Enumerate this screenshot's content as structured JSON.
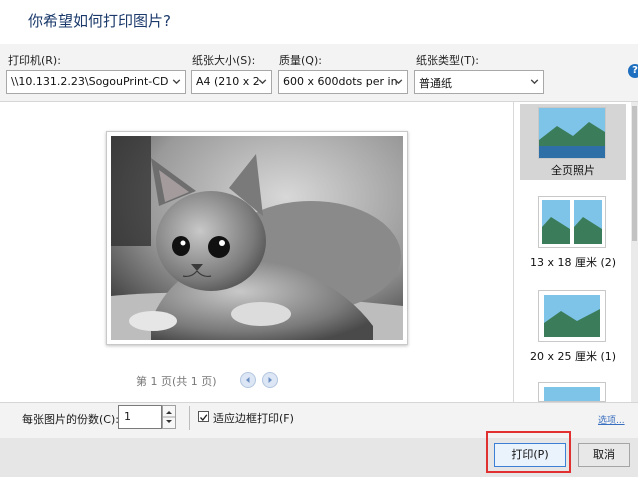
{
  "dialog": {
    "title": "你希望如何打印图片?"
  },
  "toolbar": {
    "printer": {
      "label": "打印机(R):",
      "value": "\\\\10.131.2.23\\SogouPrint-CD"
    },
    "paper_size": {
      "label": "纸张大小(S):",
      "value": "A4 (210 x 2"
    },
    "quality": {
      "label": "质量(Q):",
      "value": "600 x 600dots per in"
    },
    "paper_type": {
      "label": "纸张类型(T):",
      "value": "普通纸"
    },
    "help_icon": "?"
  },
  "preview": {
    "page_info": "第 1 页(共 1 页)",
    "image_alt": "grayscale kitten photo"
  },
  "layouts": [
    {
      "label": "全页照片",
      "selected": true
    },
    {
      "label": "13 x 18 厘米 (2)",
      "selected": false
    },
    {
      "label": "20 x 25 厘米 (1)",
      "selected": false
    }
  ],
  "options": {
    "copies_label": "每张图片的份数(C):",
    "copies_value": "1",
    "fit_label": "适应边框打印(F)",
    "fit_checked": true,
    "options_link": "选项..."
  },
  "buttons": {
    "print": "打印(P)",
    "cancel": "取消"
  },
  "colors": {
    "title": "#1b3a6b",
    "highlight": "#e03030",
    "accent": "#3c7fd4"
  }
}
